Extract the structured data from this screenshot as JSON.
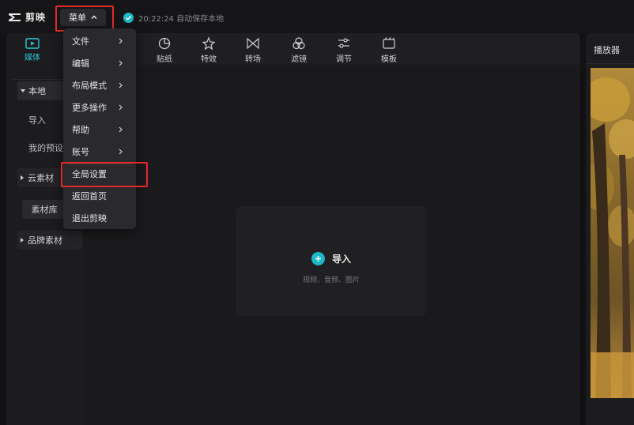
{
  "app": {
    "name": "剪映",
    "menu_label": "菜单",
    "autosave_text": "20:22:24 自动保存本地"
  },
  "colors": {
    "accent": "#1fb8c9",
    "highlight_box": "#e22a2a",
    "background": "#121214"
  },
  "leftnav": {
    "media_label": "媒体",
    "local_label": "本地",
    "import_label": "导入",
    "preset_label": "我的预设",
    "cloud_label": "云素材",
    "library_label": "素材库",
    "brand_label": "品牌素材"
  },
  "toolbar": {
    "tools": [
      {
        "label": "贴纸",
        "icon": "sticker-icon"
      },
      {
        "label": "特效",
        "icon": "effects-icon"
      },
      {
        "label": "转场",
        "icon": "transition-icon"
      },
      {
        "label": "滤镜",
        "icon": "filter-icon"
      },
      {
        "label": "调节",
        "icon": "adjust-icon"
      },
      {
        "label": "模板",
        "icon": "template-icon"
      }
    ]
  },
  "import_area": {
    "label": "导入",
    "hint": "视频、音频、图片"
  },
  "player": {
    "title": "播放器"
  },
  "menu": {
    "items": [
      {
        "label": "文件",
        "has_submenu": true
      },
      {
        "label": "编辑",
        "has_submenu": true
      },
      {
        "label": "布局模式",
        "has_submenu": true
      },
      {
        "label": "更多操作",
        "has_submenu": true
      },
      {
        "label": "帮助",
        "has_submenu": true
      },
      {
        "label": "账号",
        "has_submenu": true
      },
      {
        "label": "全局设置",
        "has_submenu": false
      },
      {
        "label": "返回首页",
        "has_submenu": false
      },
      {
        "label": "退出剪映",
        "has_submenu": false
      }
    ]
  }
}
